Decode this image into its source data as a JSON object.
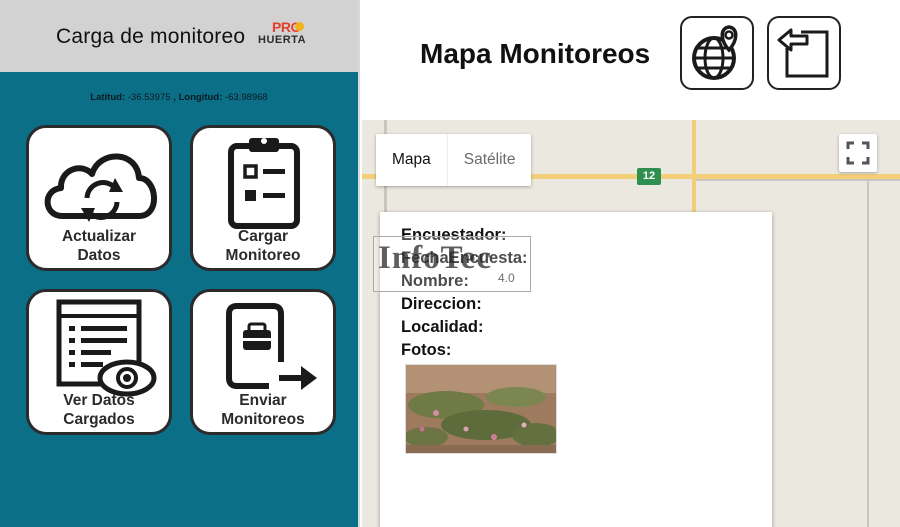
{
  "left_app": {
    "title": "Carga de monitoreo",
    "logo": {
      "top": "PRO",
      "bottom": "HUERTA"
    },
    "coords": {
      "lat_label": "Latitud:",
      "lat_value": "-36.53975",
      "lon_label": ", Longitud:",
      "lon_value": "-63.98968"
    },
    "tiles": [
      {
        "line1": "Actualizar",
        "line2": "Datos",
        "icon": "cloud-sync-icon"
      },
      {
        "line1": "Cargar",
        "line2": "Monitoreo",
        "icon": "clipboard-checklist-icon"
      },
      {
        "line1": "Ver Datos",
        "line2": "Cargados",
        "icon": "list-eye-icon"
      },
      {
        "line1": "Enviar",
        "line2": "Monitoreos",
        "icon": "clipboard-send-icon"
      }
    ]
  },
  "map_screen": {
    "title": "Mapa Monitoreos",
    "buttons": [
      {
        "icon": "globe-location-icon"
      },
      {
        "icon": "back-arrow-icon"
      }
    ],
    "map_type": {
      "map": "Mapa",
      "satellite": "Satélite"
    },
    "route_number": "12",
    "info_window": {
      "fields": [
        "Encuestador:",
        "FechaEncuesta:",
        "Nombre:",
        "Direccion:",
        "Localidad:",
        "Fotos:"
      ]
    }
  },
  "watermark": {
    "text": "InfoTec",
    "version": "4.0"
  },
  "colors": {
    "left_background": "#0b6f88",
    "header_background": "#d2d2d2",
    "route_badge": "#2f8f4e",
    "road": "#f4cf79",
    "map_background": "#eae8df"
  }
}
